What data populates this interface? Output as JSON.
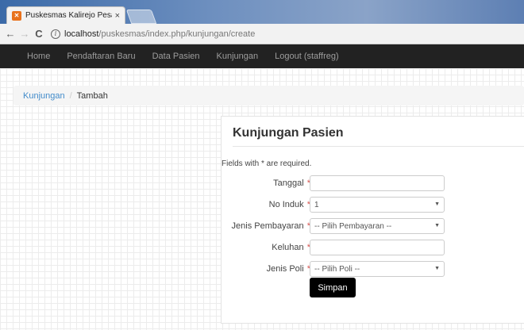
{
  "browser": {
    "tab_title": "Puskesmas Kalirejo Pesa",
    "tab_close": "×",
    "url_host": "localhost",
    "url_path": "/puskesmas/index.php/kunjungan/create",
    "back": "←",
    "forward": "→",
    "reload": "C",
    "info": "i"
  },
  "navbar": {
    "items": [
      "Home",
      "Pendaftaran Baru",
      "Data Pasien",
      "Kunjungan",
      "Logout (staffreg)"
    ]
  },
  "breadcrumb": {
    "link": "Kunjungan",
    "separator": "/",
    "active": "Tambah"
  },
  "form": {
    "title": "Kunjungan Pasien",
    "note": "Fields with * are required.",
    "required_mark": "*",
    "fields": [
      {
        "label": "Tanggal",
        "value": "",
        "type": "text"
      },
      {
        "label": "No Induk",
        "value": "1",
        "type": "select"
      },
      {
        "label": "Jenis Pembayaran",
        "value": "-- Pilih Pembayaran --",
        "type": "select"
      },
      {
        "label": "Keluhan",
        "value": "",
        "type": "text"
      },
      {
        "label": "Jenis Poli",
        "value": "-- Pilih Poli --",
        "type": "select"
      }
    ],
    "submit_label": "Simpan"
  },
  "colors": {
    "navbar_bg": "#222222",
    "link": "#428bca",
    "button_bg": "#000000"
  }
}
